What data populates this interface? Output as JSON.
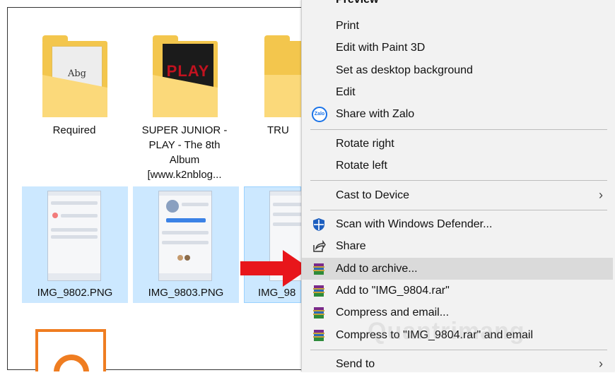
{
  "files": [
    {
      "id": "required",
      "label": "Required",
      "selected": false
    },
    {
      "id": "superjunior",
      "label_lines": [
        "SUPER JUNIOR -",
        "PLAY - The 8th",
        "Album",
        "[www.k2nblog..."
      ],
      "selected": false
    },
    {
      "id": "tru",
      "label": "TRU",
      "selected": false
    },
    {
      "id": "img9802",
      "label": "IMG_9802.PNG",
      "selected": true
    },
    {
      "id": "img9803",
      "label": "IMG_9803.PNG",
      "selected": true
    },
    {
      "id": "img9804",
      "label": "IMG_98",
      "selected": true
    }
  ],
  "folder_doc_text": "Abg",
  "album_art_text": "PLAY",
  "menu": {
    "items": [
      {
        "id": "preview",
        "label": "Preview",
        "icon": ""
      },
      {
        "id": "print",
        "label": "Print",
        "icon": ""
      },
      {
        "id": "paint3d",
        "label": "Edit with Paint 3D",
        "icon": ""
      },
      {
        "id": "desktop-bg",
        "label": "Set as desktop background",
        "icon": ""
      },
      {
        "id": "edit",
        "label": "Edit",
        "icon": ""
      },
      {
        "id": "zalo",
        "label": "Share with Zalo",
        "icon": "zalo-icon",
        "icon_text": "Zalo"
      },
      {
        "id": "rotate-right",
        "label": "Rotate right",
        "icon": ""
      },
      {
        "id": "rotate-left",
        "label": "Rotate left",
        "icon": ""
      },
      {
        "id": "cast",
        "label": "Cast to Device",
        "icon": "",
        "submenu": true
      },
      {
        "id": "defender",
        "label": "Scan with Windows Defender...",
        "icon": "windows-defender-icon"
      },
      {
        "id": "share",
        "label": "Share",
        "icon": "share-icon"
      },
      {
        "id": "add-archive",
        "label": "Add to archive...",
        "icon": "winrar-icon",
        "highlighted": true
      },
      {
        "id": "add-rar",
        "label": "Add to \"IMG_9804.rar\"",
        "icon": "winrar-icon"
      },
      {
        "id": "compress-email",
        "label": "Compress and email...",
        "icon": "winrar-icon"
      },
      {
        "id": "compress-rar-email",
        "label": "Compress to \"IMG_9804.rar\" and email",
        "icon": "winrar-icon"
      },
      {
        "id": "send-to",
        "label": "Send to",
        "icon": "",
        "submenu": true
      }
    ],
    "submenu_glyph": "›"
  },
  "watermark": "Quantrimang",
  "colors": {
    "selection": "#cce8ff",
    "menu_bg": "#f2f2f2",
    "highlight": "#dadada",
    "arrow": "#e8161b",
    "folder": "#f3c64d"
  }
}
